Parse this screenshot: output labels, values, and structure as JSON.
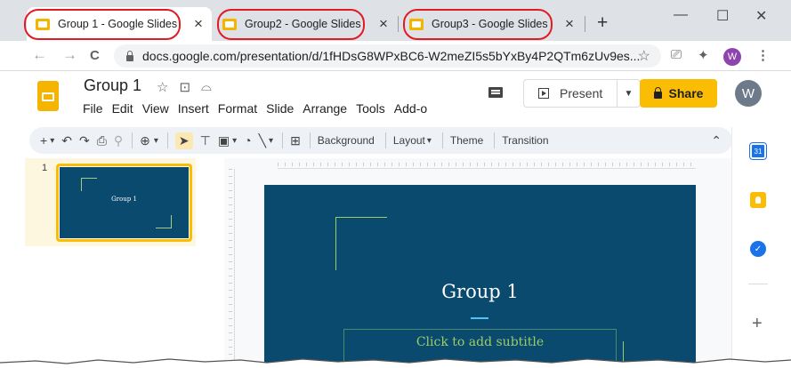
{
  "browser": {
    "tabs": [
      {
        "title": "Group 1 - Google Slides",
        "active": true
      },
      {
        "title": "Group2 - Google Slides",
        "active": false
      },
      {
        "title": "Group3 - Google Slides",
        "active": false
      }
    ],
    "close_glyph": "×",
    "new_tab_glyph": "+",
    "window_controls": {
      "minimize": "—",
      "maximize": "☐",
      "close": "✕"
    },
    "nav": {
      "back": "←",
      "forward": "→",
      "reload": "C"
    },
    "url": "docs.google.com/presentation/d/1fHDsG8WPxBC6-W2meZI5s5bYxBy4P2QTm6zUv9es...",
    "profile_initial": "W",
    "annotation_color": "#e21b22"
  },
  "docs": {
    "title": "Group 1",
    "title_icons": [
      "star-icon",
      "move-to-folder-icon",
      "cloud-status-icon"
    ],
    "menu": [
      "File",
      "Edit",
      "View",
      "Insert",
      "Format",
      "Slide",
      "Arrange",
      "Tools",
      "Add-o"
    ],
    "present_label": "Present",
    "share_label": "Share",
    "user_initial": "W",
    "accent_color": "#fbbc04"
  },
  "toolbar": {
    "background_label": "Background",
    "layout_label": "Layout",
    "theme_label": "Theme",
    "transition_label": "Transition"
  },
  "filmstrip": {
    "slides": [
      {
        "number": "1",
        "title": "Group 1"
      }
    ]
  },
  "slide": {
    "title": "Group 1",
    "subtitle_placeholder": "Click to add subtitle",
    "background_color": "#0a4a6e",
    "accent_color": "#9ccc65"
  },
  "side_panel": {
    "icons": [
      "calendar-icon",
      "keep-icon",
      "tasks-icon",
      "add-addon-icon"
    ],
    "calendar_day": "31"
  }
}
